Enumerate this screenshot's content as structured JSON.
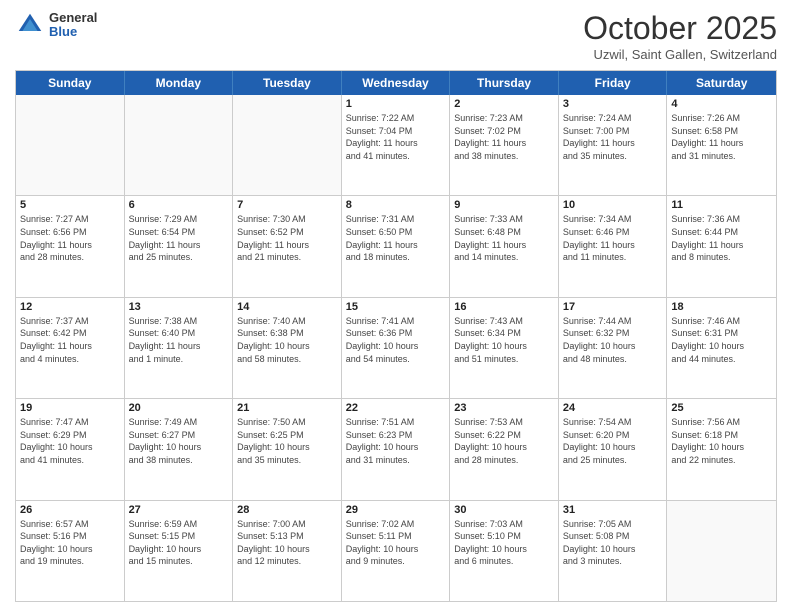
{
  "header": {
    "logo_general": "General",
    "logo_blue": "Blue",
    "month_title": "October 2025",
    "location": "Uzwil, Saint Gallen, Switzerland"
  },
  "days_of_week": [
    "Sunday",
    "Monday",
    "Tuesday",
    "Wednesday",
    "Thursday",
    "Friday",
    "Saturday"
  ],
  "weeks": [
    [
      {
        "day": "",
        "info": ""
      },
      {
        "day": "",
        "info": ""
      },
      {
        "day": "",
        "info": ""
      },
      {
        "day": "1",
        "info": "Sunrise: 7:22 AM\nSunset: 7:04 PM\nDaylight: 11 hours\nand 41 minutes."
      },
      {
        "day": "2",
        "info": "Sunrise: 7:23 AM\nSunset: 7:02 PM\nDaylight: 11 hours\nand 38 minutes."
      },
      {
        "day": "3",
        "info": "Sunrise: 7:24 AM\nSunset: 7:00 PM\nDaylight: 11 hours\nand 35 minutes."
      },
      {
        "day": "4",
        "info": "Sunrise: 7:26 AM\nSunset: 6:58 PM\nDaylight: 11 hours\nand 31 minutes."
      }
    ],
    [
      {
        "day": "5",
        "info": "Sunrise: 7:27 AM\nSunset: 6:56 PM\nDaylight: 11 hours\nand 28 minutes."
      },
      {
        "day": "6",
        "info": "Sunrise: 7:29 AM\nSunset: 6:54 PM\nDaylight: 11 hours\nand 25 minutes."
      },
      {
        "day": "7",
        "info": "Sunrise: 7:30 AM\nSunset: 6:52 PM\nDaylight: 11 hours\nand 21 minutes."
      },
      {
        "day": "8",
        "info": "Sunrise: 7:31 AM\nSunset: 6:50 PM\nDaylight: 11 hours\nand 18 minutes."
      },
      {
        "day": "9",
        "info": "Sunrise: 7:33 AM\nSunset: 6:48 PM\nDaylight: 11 hours\nand 14 minutes."
      },
      {
        "day": "10",
        "info": "Sunrise: 7:34 AM\nSunset: 6:46 PM\nDaylight: 11 hours\nand 11 minutes."
      },
      {
        "day": "11",
        "info": "Sunrise: 7:36 AM\nSunset: 6:44 PM\nDaylight: 11 hours\nand 8 minutes."
      }
    ],
    [
      {
        "day": "12",
        "info": "Sunrise: 7:37 AM\nSunset: 6:42 PM\nDaylight: 11 hours\nand 4 minutes."
      },
      {
        "day": "13",
        "info": "Sunrise: 7:38 AM\nSunset: 6:40 PM\nDaylight: 11 hours\nand 1 minute."
      },
      {
        "day": "14",
        "info": "Sunrise: 7:40 AM\nSunset: 6:38 PM\nDaylight: 10 hours\nand 58 minutes."
      },
      {
        "day": "15",
        "info": "Sunrise: 7:41 AM\nSunset: 6:36 PM\nDaylight: 10 hours\nand 54 minutes."
      },
      {
        "day": "16",
        "info": "Sunrise: 7:43 AM\nSunset: 6:34 PM\nDaylight: 10 hours\nand 51 minutes."
      },
      {
        "day": "17",
        "info": "Sunrise: 7:44 AM\nSunset: 6:32 PM\nDaylight: 10 hours\nand 48 minutes."
      },
      {
        "day": "18",
        "info": "Sunrise: 7:46 AM\nSunset: 6:31 PM\nDaylight: 10 hours\nand 44 minutes."
      }
    ],
    [
      {
        "day": "19",
        "info": "Sunrise: 7:47 AM\nSunset: 6:29 PM\nDaylight: 10 hours\nand 41 minutes."
      },
      {
        "day": "20",
        "info": "Sunrise: 7:49 AM\nSunset: 6:27 PM\nDaylight: 10 hours\nand 38 minutes."
      },
      {
        "day": "21",
        "info": "Sunrise: 7:50 AM\nSunset: 6:25 PM\nDaylight: 10 hours\nand 35 minutes."
      },
      {
        "day": "22",
        "info": "Sunrise: 7:51 AM\nSunset: 6:23 PM\nDaylight: 10 hours\nand 31 minutes."
      },
      {
        "day": "23",
        "info": "Sunrise: 7:53 AM\nSunset: 6:22 PM\nDaylight: 10 hours\nand 28 minutes."
      },
      {
        "day": "24",
        "info": "Sunrise: 7:54 AM\nSunset: 6:20 PM\nDaylight: 10 hours\nand 25 minutes."
      },
      {
        "day": "25",
        "info": "Sunrise: 7:56 AM\nSunset: 6:18 PM\nDaylight: 10 hours\nand 22 minutes."
      }
    ],
    [
      {
        "day": "26",
        "info": "Sunrise: 6:57 AM\nSunset: 5:16 PM\nDaylight: 10 hours\nand 19 minutes."
      },
      {
        "day": "27",
        "info": "Sunrise: 6:59 AM\nSunset: 5:15 PM\nDaylight: 10 hours\nand 15 minutes."
      },
      {
        "day": "28",
        "info": "Sunrise: 7:00 AM\nSunset: 5:13 PM\nDaylight: 10 hours\nand 12 minutes."
      },
      {
        "day": "29",
        "info": "Sunrise: 7:02 AM\nSunset: 5:11 PM\nDaylight: 10 hours\nand 9 minutes."
      },
      {
        "day": "30",
        "info": "Sunrise: 7:03 AM\nSunset: 5:10 PM\nDaylight: 10 hours\nand 6 minutes."
      },
      {
        "day": "31",
        "info": "Sunrise: 7:05 AM\nSunset: 5:08 PM\nDaylight: 10 hours\nand 3 minutes."
      },
      {
        "day": "",
        "info": ""
      }
    ]
  ]
}
